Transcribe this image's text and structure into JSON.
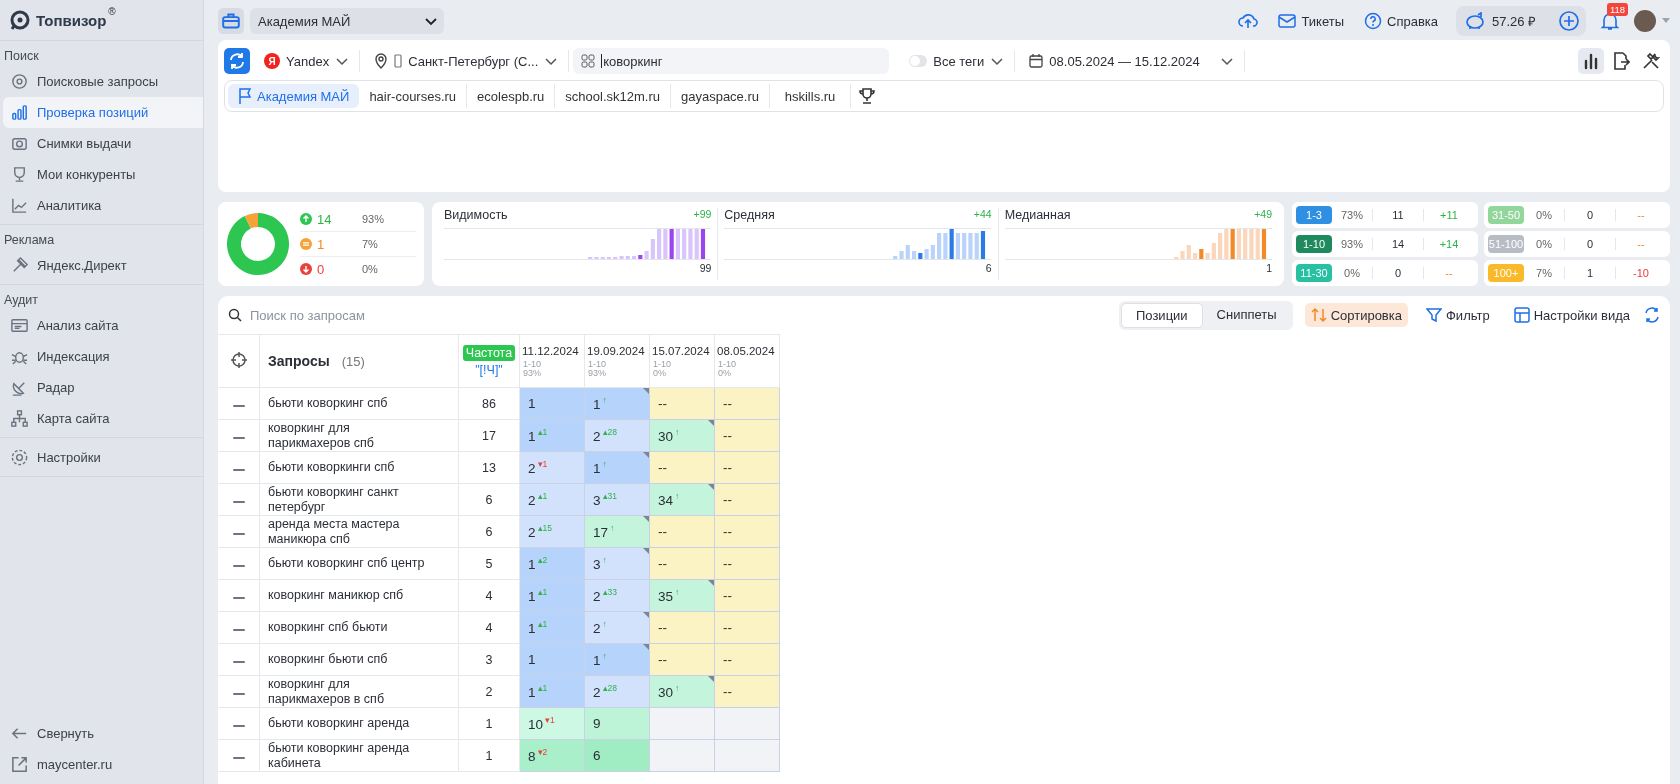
{
  "sidebar": {
    "logo": "Топвизор",
    "logo_mark": "®",
    "sections": [
      {
        "title": "Поиск",
        "items": [
          {
            "label": "Поисковые запросы",
            "selected": false
          },
          {
            "label": "Проверка позиций",
            "selected": true
          },
          {
            "label": "Снимки выдачи",
            "selected": false
          },
          {
            "label": "Мои конкуренты",
            "selected": false
          },
          {
            "label": "Аналитика",
            "selected": false
          }
        ]
      },
      {
        "title": "Реклама",
        "items": [
          {
            "label": "Яндекс.Директ",
            "selected": false
          }
        ]
      },
      {
        "title": "Аудит",
        "items": [
          {
            "label": "Анализ сайта",
            "selected": false
          },
          {
            "label": "Индексация",
            "selected": false
          },
          {
            "label": "Радар",
            "selected": false
          },
          {
            "label": "Карта сайта",
            "selected": false
          }
        ]
      },
      {
        "items": [
          {
            "label": "Настройки",
            "selected": false
          }
        ]
      }
    ],
    "footer": [
      {
        "label": "Свернуть"
      },
      {
        "label": "maycenter.ru"
      }
    ]
  },
  "topbar": {
    "project": "Академия МАЙ",
    "links": [
      {
        "label": "Тикеты"
      },
      {
        "label": "Справка"
      }
    ],
    "balance": "57.26 ₽",
    "notifications": "118"
  },
  "filters": {
    "engine": "Yandex",
    "engine_mark": "Я",
    "region": "Санкт-Петербург (С...",
    "search": "коворкинг",
    "tags": {
      "label": "Все теги",
      "on": false
    },
    "dates": "08.05.2024 — 15.12.2024",
    "view_buttons": [
      {
        "selected": true
      },
      {
        "selected": false
      },
      {
        "selected": false
      }
    ]
  },
  "competitors": [
    {
      "label": "Академия МАЙ",
      "selected": true
    },
    {
      "label": "hair-courses.ru",
      "selected": false
    },
    {
      "label": "ecolespb.ru",
      "selected": false
    },
    {
      "label": "school.sk12m.ru",
      "selected": false
    },
    {
      "label": "gayaspace.ru",
      "selected": false
    },
    {
      "label": "hskills.ru",
      "selected": false
    }
  ],
  "summary": {
    "chart_data": {
      "type": "donut",
      "values": [
        93,
        7,
        0
      ]
    },
    "legend": [
      {
        "kind": "up",
        "count": "14",
        "percent": "93%"
      },
      {
        "kind": "same",
        "count": "1",
        "percent": "7%"
      },
      {
        "kind": "down",
        "count": "0",
        "percent": "0%"
      }
    ]
  },
  "metrics": [
    {
      "title": "Видимость",
      "delta": "+99",
      "value": "99"
    },
    {
      "title": "Средняя",
      "delta": "+44",
      "value": "6"
    },
    {
      "title": "Медианная",
      "delta": "+49",
      "value": "1"
    }
  ],
  "ranges": [
    {
      "label": "1-3",
      "color": "#2f8fe3",
      "percent": "73%",
      "count": "11",
      "delta": "+11",
      "kind": "up"
    },
    {
      "label": "31-50",
      "color": "#93d69b",
      "percent": "0%",
      "count": "0",
      "delta": "--",
      "kind": "none"
    },
    {
      "label": "1-10",
      "color": "#1f8a5e",
      "percent": "93%",
      "count": "14",
      "delta": "+14",
      "kind": "up"
    },
    {
      "label": "51-100",
      "color": "#b8bdc5",
      "percent": "0%",
      "count": "0",
      "delta": "--",
      "kind": "none"
    },
    {
      "label": "11-30",
      "color": "#27c0a2",
      "percent": "0%",
      "count": "0",
      "delta": "--",
      "kind": "none"
    },
    {
      "label": "100+",
      "color": "#f9b928",
      "percent": "7%",
      "count": "1",
      "delta": "-10",
      "kind": "down"
    }
  ],
  "toolbar": {
    "search_placeholder": "Поиск по запросам",
    "tabs": [
      {
        "label": "Позиции",
        "selected": true
      },
      {
        "label": "Сниппеты",
        "selected": false
      }
    ],
    "buttons": [
      {
        "label": "Сортировка",
        "active": true
      },
      {
        "label": "Фильтр",
        "active": false
      },
      {
        "label": "Настройки вида",
        "active": false
      }
    ]
  },
  "table": {
    "query_header": "Запросы",
    "query_count": "(15)",
    "freq_badge": "Частота",
    "freq_type": "\"[!Ч]\"",
    "dates": [
      {
        "date": "11.12.2024",
        "range": "1-10",
        "share": "93%"
      },
      {
        "date": "19.09.2024",
        "range": "1-10",
        "share": "93%"
      },
      {
        "date": "15.07.2024",
        "range": "1-10",
        "share": "0%"
      },
      {
        "date": "08.05.2024",
        "range": "1-10",
        "share": "0%"
      }
    ],
    "rows": [
      {
        "query": "бьюти коворкинг спб",
        "freq": "86",
        "positions": [
          {
            "value": "1",
            "flagged": false,
            "color": "#b5d3fb"
          },
          {
            "value": "1",
            "delta": "↑",
            "kind": "up",
            "flagged": true,
            "color": "#b5d3fb"
          },
          {
            "value": "--",
            "flagged": false,
            "color": "#fcf3c5"
          },
          {
            "value": "--",
            "flagged": false,
            "color": "#fcf3c5"
          }
        ]
      },
      {
        "query": "коворкинг для парикмахеров спб",
        "freq": "17",
        "positions": [
          {
            "value": "1",
            "delta": "▴1",
            "kind": "up",
            "flagged": false,
            "color": "#b5d3fb"
          },
          {
            "value": "2",
            "delta": "▴28",
            "kind": "up",
            "flagged": false,
            "color": "#d2e2fc"
          },
          {
            "value": "30",
            "delta": "↑",
            "kind": "up",
            "flagged": true,
            "color": "#c4f5dc"
          },
          {
            "value": "--",
            "flagged": false,
            "color": "#fcf3c5"
          }
        ]
      },
      {
        "query": "бьюти коворкинги спб",
        "freq": "13",
        "positions": [
          {
            "value": "2",
            "delta": "▾1",
            "kind": "down",
            "flagged": false,
            "color": "#d2e2fc"
          },
          {
            "value": "1",
            "delta": "↑",
            "kind": "up",
            "flagged": true,
            "color": "#b5d3fb"
          },
          {
            "value": "--",
            "flagged": false,
            "color": "#fcf3c5"
          },
          {
            "value": "--",
            "flagged": false,
            "color": "#fcf3c5"
          }
        ]
      },
      {
        "query": "бьюти коворкинг санкт петербург",
        "freq": "6",
        "positions": [
          {
            "value": "2",
            "delta": "▴1",
            "kind": "up",
            "flagged": false,
            "color": "#d2e2fc"
          },
          {
            "value": "3",
            "delta": "▴31",
            "kind": "up",
            "flagged": false,
            "color": "#d2e2fc"
          },
          {
            "value": "34",
            "delta": "↑",
            "kind": "up",
            "flagged": true,
            "color": "#c4f5dc"
          },
          {
            "value": "--",
            "flagged": false,
            "color": "#fcf3c5"
          }
        ]
      },
      {
        "query": "аренда места мастера маникюра спб",
        "freq": "6",
        "positions": [
          {
            "value": "2",
            "delta": "▴15",
            "kind": "up",
            "flagged": false,
            "color": "#d2e2fc"
          },
          {
            "value": "17",
            "delta": "↑",
            "kind": "up",
            "flagged": true,
            "color": "#c4f5dc"
          },
          {
            "value": "--",
            "flagged": false,
            "color": "#fcf3c5"
          },
          {
            "value": "--",
            "flagged": false,
            "color": "#fcf3c5"
          }
        ]
      },
      {
        "query": "бьюти коворкинг спб центр",
        "freq": "5",
        "positions": [
          {
            "value": "1",
            "delta": "▴2",
            "kind": "up",
            "flagged": false,
            "color": "#b5d3fb"
          },
          {
            "value": "3",
            "delta": "↑",
            "kind": "up",
            "flagged": true,
            "color": "#d2e2fc"
          },
          {
            "value": "--",
            "flagged": false,
            "color": "#fcf3c5"
          },
          {
            "value": "--",
            "flagged": false,
            "color": "#fcf3c5"
          }
        ]
      },
      {
        "query": "коворкинг маникюр спб",
        "freq": "4",
        "positions": [
          {
            "value": "1",
            "delta": "▴1",
            "kind": "up",
            "flagged": false,
            "color": "#b5d3fb"
          },
          {
            "value": "2",
            "delta": "▴33",
            "kind": "up",
            "flagged": false,
            "color": "#d2e2fc"
          },
          {
            "value": "35",
            "delta": "↑",
            "kind": "up",
            "flagged": true,
            "color": "#c4f5dc"
          },
          {
            "value": "--",
            "flagged": false,
            "color": "#fcf3c5"
          }
        ]
      },
      {
        "query": "коворкинг спб бьюти",
        "freq": "4",
        "positions": [
          {
            "value": "1",
            "delta": "▴1",
            "kind": "up",
            "flagged": false,
            "color": "#b5d3fb"
          },
          {
            "value": "2",
            "delta": "↑",
            "kind": "up",
            "flagged": true,
            "color": "#d2e2fc"
          },
          {
            "value": "--",
            "flagged": false,
            "color": "#fcf3c5"
          },
          {
            "value": "--",
            "flagged": false,
            "color": "#fcf3c5"
          }
        ]
      },
      {
        "query": "коворкинг бьюти спб",
        "freq": "3",
        "positions": [
          {
            "value": "1",
            "flagged": false,
            "color": "#b5d3fb"
          },
          {
            "value": "1",
            "delta": "↑",
            "kind": "up",
            "flagged": true,
            "color": "#b5d3fb"
          },
          {
            "value": "--",
            "flagged": false,
            "color": "#fcf3c5"
          },
          {
            "value": "--",
            "flagged": false,
            "color": "#fcf3c5"
          }
        ]
      },
      {
        "query": "коворкинг для парикмахеров в спб",
        "freq": "2",
        "positions": [
          {
            "value": "1",
            "delta": "▴1",
            "kind": "up",
            "flagged": false,
            "color": "#b5d3fb"
          },
          {
            "value": "2",
            "delta": "▴28",
            "kind": "up",
            "flagged": false,
            "color": "#d2e2fc"
          },
          {
            "value": "30",
            "delta": "↑",
            "kind": "up",
            "flagged": true,
            "color": "#c4f5dc"
          },
          {
            "value": "--",
            "flagged": false,
            "color": "#fcf3c5"
          }
        ]
      },
      {
        "query": "бьюти коворкинг аренда",
        "freq": "1",
        "positions": [
          {
            "value": "10",
            "delta": "▾1",
            "kind": "down",
            "flagged": false,
            "color": "#cdf8e4"
          },
          {
            "value": "9",
            "flagged": false,
            "color": "#bdf4d8"
          },
          {
            "flagged": false,
            "color": "#f2f3f6"
          },
          {
            "flagged": false,
            "color": "#f2f3f6"
          }
        ]
      },
      {
        "query": "бьюти коворкинг аренда кабинета",
        "freq": "1",
        "positions": [
          {
            "value": "8",
            "delta": "▾2",
            "kind": "down",
            "flagged": false,
            "color": "#a9efca"
          },
          {
            "value": "6",
            "flagged": false,
            "color": "#a0edc4"
          },
          {
            "flagged": false,
            "color": "#f2f3f6"
          },
          {
            "flagged": false,
            "color": "#f2f3f6"
          }
        ]
      }
    ]
  }
}
